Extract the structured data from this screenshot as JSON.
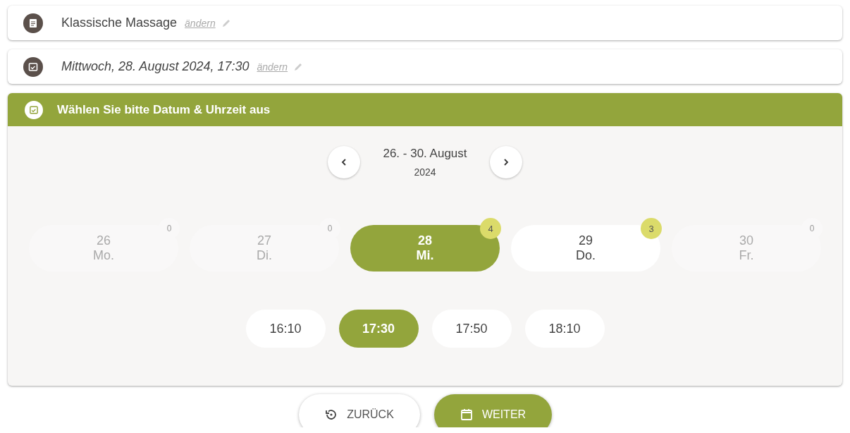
{
  "summary": [
    {
      "kind": "service",
      "text": "Klassische Massage",
      "italic": false,
      "link": "ändern"
    },
    {
      "kind": "date",
      "text": "Mittwoch, 28. August 2024, 17:30",
      "italic": true,
      "link": "ändern"
    }
  ],
  "panel": {
    "title": "Wählen Sie bitte Datum & Uhrzeit aus",
    "range": "26. - 30. August",
    "year": "2024",
    "days": [
      {
        "day": "26",
        "weekday": "Mo.",
        "count": "0",
        "selected": false,
        "disabled": true
      },
      {
        "day": "27",
        "weekday": "Di.",
        "count": "0",
        "selected": false,
        "disabled": true
      },
      {
        "day": "28",
        "weekday": "Mi.",
        "count": "4",
        "selected": true,
        "disabled": false
      },
      {
        "day": "29",
        "weekday": "Do.",
        "count": "3",
        "selected": false,
        "disabled": false
      },
      {
        "day": "30",
        "weekday": "Fr.",
        "count": "0",
        "selected": false,
        "disabled": true
      }
    ],
    "times": [
      {
        "label": "16:10",
        "selected": false
      },
      {
        "label": "17:30",
        "selected": true
      },
      {
        "label": "17:50",
        "selected": false
      },
      {
        "label": "18:10",
        "selected": false
      }
    ]
  },
  "buttons": [
    {
      "kind": "back",
      "label": "ZURÜCK"
    },
    {
      "kind": "next",
      "label": "WEITER"
    }
  ]
}
